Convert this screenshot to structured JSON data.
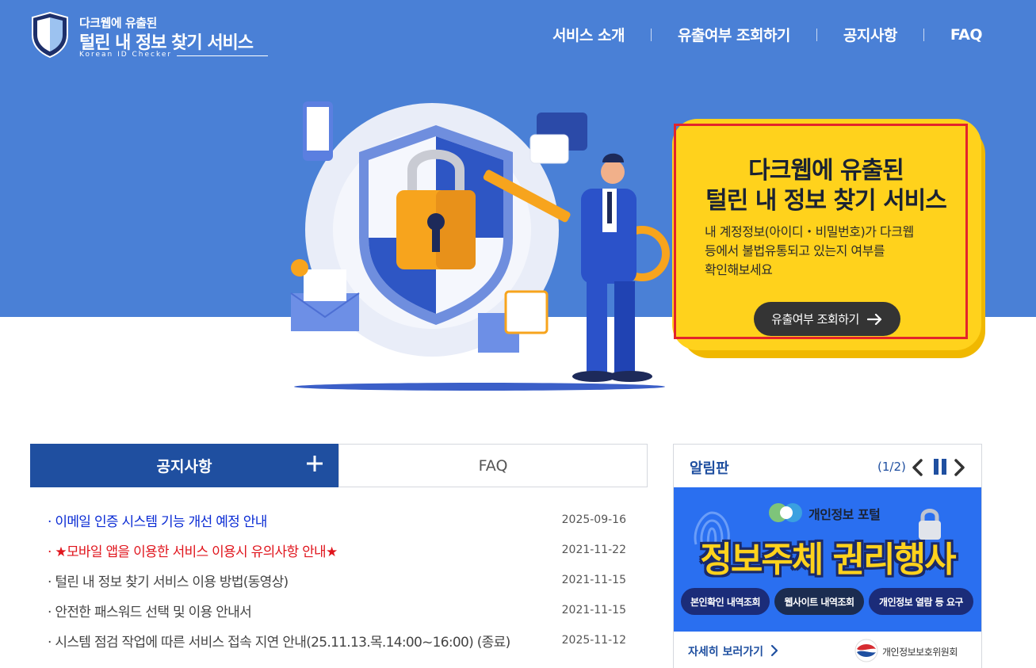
{
  "header": {
    "logo": {
      "line1": "다크웹에 유출된",
      "line2": "털린 내 정보 찾기 서비스",
      "sub": "Korean ID Checker"
    },
    "nav": [
      {
        "label": "서비스 소개"
      },
      {
        "label": "유출여부 조회하기"
      },
      {
        "label": "공지사항"
      },
      {
        "label": "FAQ"
      }
    ]
  },
  "promo": {
    "title_line1": "다크웹에 유출된",
    "title_line2": "털린 내 정보 찾기 서비스",
    "desc_line1": "내 계정정보(아이디・비밀번호)가 다크웹",
    "desc_line2": "등에서 불법유통되고 있는지 여부를",
    "desc_line3": "확인해보세요",
    "button_label": "유출여부 조회하기"
  },
  "tabs": {
    "notice": "공지사항",
    "faq": "FAQ"
  },
  "notices": [
    {
      "title": "이메일 인증 시스템 기능 개선 예정 안내",
      "date": "2025-09-16",
      "style": "blue"
    },
    {
      "title": "★모바일 앱을 이용한 서비스 이용시 유의사항 안내★",
      "date": "2021-11-22",
      "style": "red"
    },
    {
      "title": "털린 내 정보 찾기 서비스 이용 방법(동영상)",
      "date": "2021-11-15",
      "style": "normal"
    },
    {
      "title": "안전한 패스워드 선택 및 이용 안내서",
      "date": "2021-11-15",
      "style": "normal"
    },
    {
      "title": "시스템 점검 작업에 따른 서비스 접속 지연 안내(25.11.13.목.14:00~16:00) (종료)",
      "date": "2025-11-12",
      "style": "normal"
    }
  ],
  "board": {
    "title": "알림판",
    "page": "(1/2)",
    "banner": {
      "portal": "개인정보 포털",
      "headline": "정보주체 권리행사",
      "pills": [
        "본인확인 내역조회",
        "웹사이트 내역조회",
        "개인정보 열람 등 요구"
      ]
    },
    "more": "자세히 보러가기",
    "org": "개인정보보호위원회"
  },
  "colors": {
    "hero_blue": "#4a80d6",
    "navy": "#1f4fa0",
    "promo_yellow": "#ffd21c",
    "notice_blue": "#0a2bd4",
    "notice_red": "#e0151d"
  }
}
